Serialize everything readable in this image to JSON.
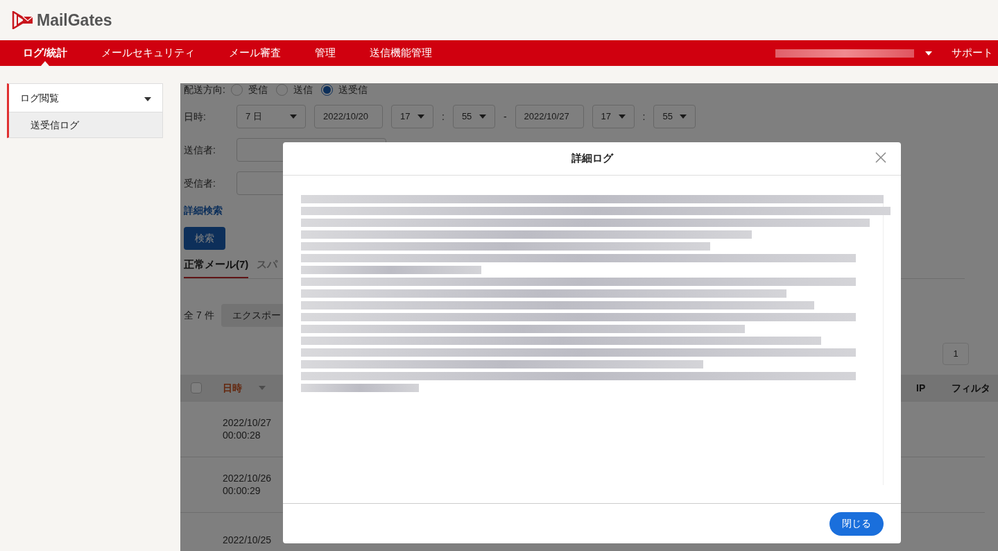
{
  "logo": {
    "text": "MailGates"
  },
  "nav": {
    "items": [
      {
        "label": "ログ/統計",
        "selected": true
      },
      {
        "label": "メールセキュリティ",
        "selected": false
      },
      {
        "label": "メール審査",
        "selected": false
      },
      {
        "label": "管理",
        "selected": false
      },
      {
        "label": "送信機能管理",
        "selected": false
      }
    ],
    "support": "サポート"
  },
  "sidebar": {
    "group": {
      "label": "ログ閲覧",
      "expanded": true
    },
    "items": [
      {
        "label": "送受信ログ",
        "selected": true
      }
    ]
  },
  "filters": {
    "direction_label": "配送方向:",
    "directions": [
      {
        "label": "受信",
        "selected": false
      },
      {
        "label": "送信",
        "selected": false
      },
      {
        "label": "送受信",
        "selected": true
      }
    ],
    "datetime_label": "日時:",
    "range": "7 日",
    "from_date": "2022/10/20",
    "from_hour": "17",
    "from_minute": "55",
    "dash": "-",
    "to_date": "2022/10/27",
    "to_hour": "17",
    "to_minute": "55",
    "colon": ":",
    "sender_label": "送信者:",
    "recipient_label": "受信者:",
    "advanced_link": "詳細検索",
    "search_button": "検索"
  },
  "result_tabs": [
    {
      "label": "正常メール(7)",
      "selected": true
    },
    {
      "label": "スパ",
      "selected": false
    }
  ],
  "total": "全 7 件",
  "export_button": "エクスポー",
  "pagination": [
    {
      "label": "1",
      "selected": false
    }
  ],
  "table": {
    "select_all": {
      "checked": false
    },
    "columns": [
      {
        "label": "日時",
        "sorted": true
      },
      {
        "label": "IP",
        "sorted": false
      },
      {
        "label": "フィルタ",
        "sorted": false
      }
    ],
    "rows": [
      {
        "date": "2022/10/27",
        "time": "00:00:28"
      },
      {
        "date": "2022/10/26",
        "time": "00:00:29"
      },
      {
        "date": "2022/10/25"
      }
    ]
  },
  "modal": {
    "title": "詳細ログ",
    "close_button": "閉じる"
  }
}
